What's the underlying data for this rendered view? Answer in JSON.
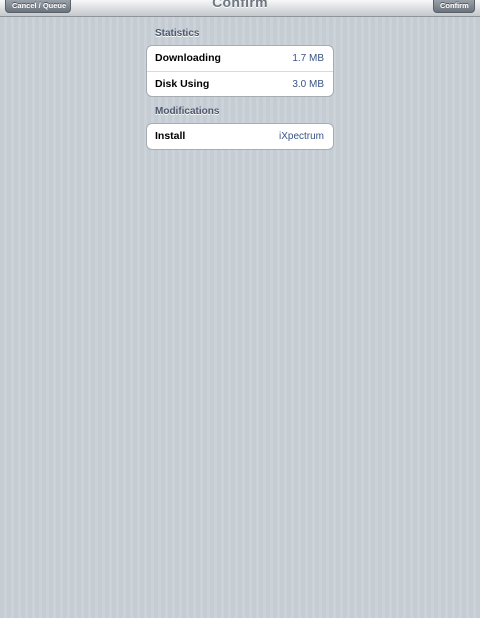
{
  "navbar": {
    "title": "Confirm",
    "left_button": "Cancel / Queue",
    "right_button": "Confirm"
  },
  "statistics": {
    "header": "Statistics",
    "rows": [
      {
        "label": "Downloading",
        "value": "1.7 MB"
      },
      {
        "label": "Disk Using",
        "value": "3.0 MB"
      }
    ]
  },
  "modifications": {
    "header": "Modifications",
    "rows": [
      {
        "label": "Install",
        "value": "iXpectrum"
      }
    ]
  },
  "colors": {
    "background": "#c5ccd4",
    "section_header": "#4c566c",
    "value_text": "#385487"
  }
}
